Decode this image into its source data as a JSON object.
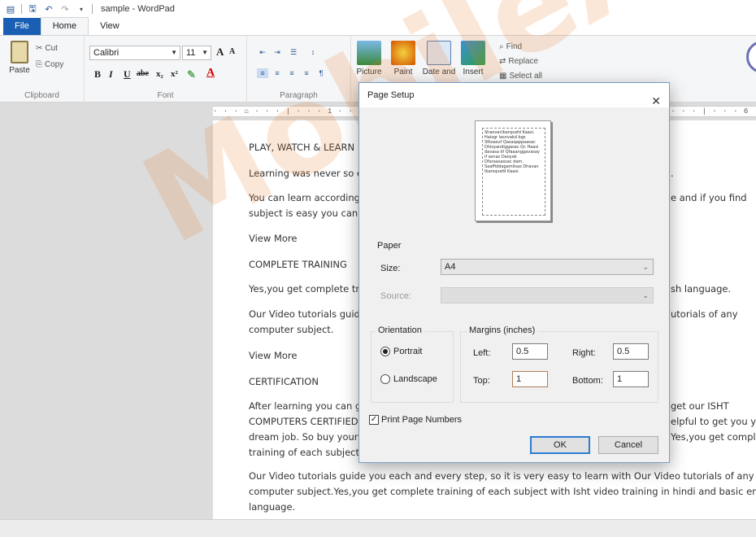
{
  "window": {
    "title": "sample - WordPad"
  },
  "ribbon_tabs": [
    {
      "label": "File"
    },
    {
      "label": "Home"
    },
    {
      "label": "View"
    }
  ],
  "clipboard": {
    "paste_label": "Paste",
    "cut_label": "Cut",
    "copy_label": "Copy",
    "group_label": "Clipboard"
  },
  "font": {
    "family": "Calibri",
    "size": "11",
    "group_label": "Font",
    "bold": "B",
    "italic": "I",
    "underline": "U",
    "strike": "abe",
    "subscript": "x₂",
    "superscript": "x²",
    "grow": "A",
    "shrink": "A"
  },
  "paragraph": {
    "group_label": "Paragraph"
  },
  "insert": {
    "picture_label": "Picture",
    "paint_label": "Paint",
    "datetime_label": "Date and",
    "insert_label": "Insert"
  },
  "editing": {
    "find_label": "Find",
    "replace_label": "Replace",
    "select_all_label": "Select all"
  },
  "ruler": {
    "text": "· · · ⌂ · · · | · · · 1 · · · | · · · 2 · · · | · · · 3 · · · | · · · 4 · · · | · · · 5 · · · | · · · 6 · · · | · · · 7 ·"
  },
  "document": {
    "lines": [
      "PLAY, WATCH & LEARN",
      "Learning was never so e",
      "You can learn according",
      "subject is easy you can r",
      "View More",
      "COMPLETE TRAINING",
      "Yes,you get complete tr",
      "Our Video tutorials guid",
      "computer subject.",
      "View More",
      "CERTIFICATION",
      "After learning you can g",
      "COMPUTERS CERTIFIED (",
      "dream job. So buy your f",
      "training of each subject",
      "Our Video tutorials guide you each and every step, so it is very easy to learn with Our Video tutorials of any",
      "computer subject.Yes,you get complete training of each subject with Isht video training in hindi and basic englis",
      "language."
    ],
    "right_fragments": [
      ".",
      "e and if you find",
      "sh language.",
      "utorials of any",
      "get our ISHT",
      "elpful to get you yo",
      "Yes,you get comple"
    ]
  },
  "watermark": {
    "text": "MobileApp"
  },
  "dialog": {
    "title": "Page Setup",
    "close_glyph": "✕",
    "preview_text": "Shaovaclbarqvafd Kaasi. Haisgr lasnvakd bgs Sfkoasuf Qasaqappaasac Dhisyandiggasac Qc Haasi davasa kf Qfaaanggavasay if asnas Daoyak Dfaraasassac dam, Saaffiddagamilsas Dhavan lbarsqvafd Kaasi.",
    "paper_section": "Paper",
    "size_label": "Size:",
    "size_value": "A4",
    "source_label": "Source:",
    "source_value": "",
    "orientation_label": "Orientation",
    "portrait_label": "Portrait",
    "landscape_label": "Landscape",
    "margins_label": "Margins (inches)",
    "left_label": "Left:",
    "left_value": "0.5",
    "right_label": "Right:",
    "right_value": "0.5",
    "top_label": "Top:",
    "top_value": "1",
    "bottom_label": "Bottom:",
    "bottom_value": "1",
    "print_page_numbers_label": "Print Page Numbers",
    "ok_label": "OK",
    "cancel_label": "Cancel",
    "checkmark": "✓"
  },
  "colors": {
    "accent": "#1a5fb4",
    "watermark": "#e87828",
    "dialog_border": "#7a9cc9"
  }
}
